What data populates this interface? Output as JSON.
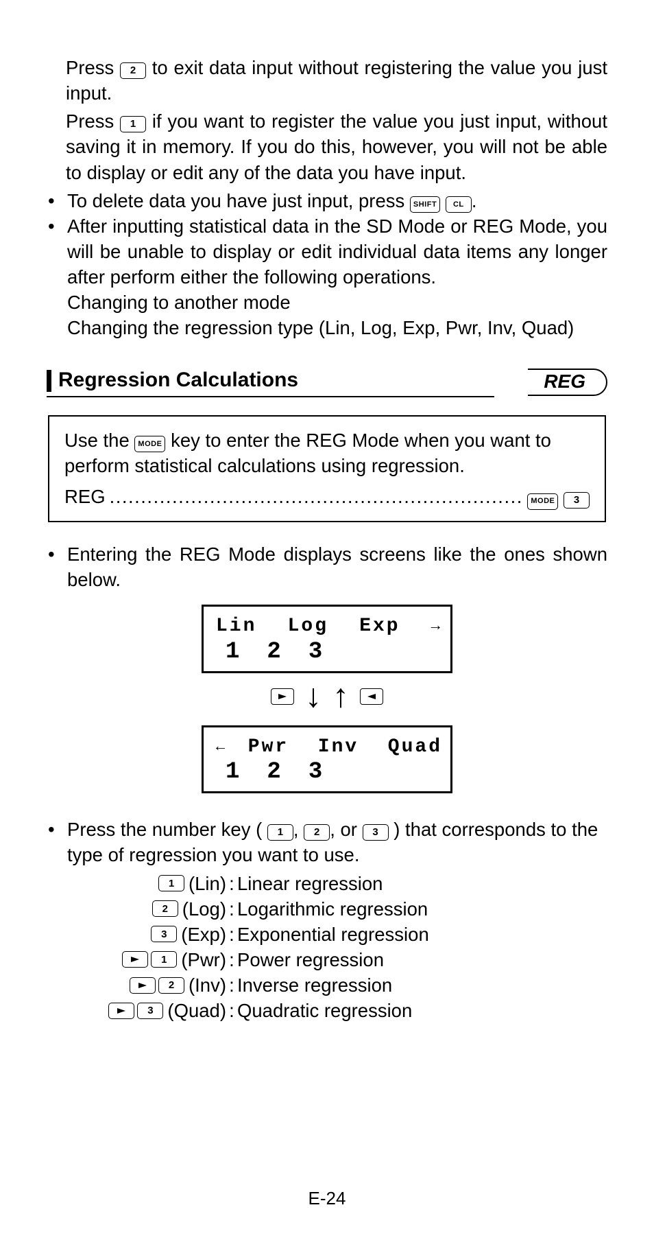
{
  "top": {
    "p1a": "Press ",
    "p1b": " to exit data input without registering the value you just input.",
    "p2a": "Press ",
    "p2b": " if you want to register the value you just input, without saving it in memory. If you do this, however, you will not be able to display or edit any of the data you have input."
  },
  "bul1": {
    "a": "To delete data you have just input, press ",
    "b": "."
  },
  "bul2": {
    "a": "After inputting statistical data in the SD Mode or REG Mode, you will be unable to display or edit individual data items any longer after perform either the following operations.",
    "b": "Changing to another mode",
    "c": "Changing the regression type (Lin, Log, Exp, Pwr, Inv, Quad)"
  },
  "section": {
    "title": "Regression Calculations",
    "badge": "REG"
  },
  "box": {
    "line1a": "Use the ",
    "line1b": " key to enter the REG Mode when you want to perform statistical calculations using regression.",
    "reg_label": "REG",
    "dots": ".................................................................."
  },
  "bul3": "Entering the REG Mode displays screens like the ones shown below.",
  "lcd1": {
    "c1": "Lin",
    "c2": "Log",
    "c3": "Exp",
    "n1": "1",
    "n2": "2",
    "n3": "3"
  },
  "lcd2": {
    "c1": "Pwr",
    "c2": "Inv",
    "c3": "Quad",
    "n1": "1",
    "n2": "2",
    "n3": "3"
  },
  "swap": {
    "down": "↓",
    "up": "↑"
  },
  "bul4": {
    "a": "Press the number key (",
    "mid1": ", ",
    "mid2": ", or ",
    "b": ") that corresponds to the type of regression you want to use."
  },
  "keys": {
    "k1": "1",
    "k2": "2",
    "k3": "3",
    "mode": "MODE",
    "shift": "SHIFT",
    "cl": "CL"
  },
  "regtypes": [
    {
      "arrow": false,
      "key": "1",
      "short": "(Lin)",
      "desc": "Linear regression"
    },
    {
      "arrow": false,
      "key": "2",
      "short": "(Log)",
      "desc": "Logarithmic regression"
    },
    {
      "arrow": false,
      "key": "3",
      "short": "(Exp)",
      "desc": "Exponential regression"
    },
    {
      "arrow": true,
      "key": "1",
      "short": "(Pwr)",
      "desc": "Power regression"
    },
    {
      "arrow": true,
      "key": "2",
      "short": "(Inv)",
      "desc": "Inverse regression"
    },
    {
      "arrow": true,
      "key": "3",
      "short": "(Quad)",
      "desc": "Quadratic regression"
    }
  ],
  "page_num": "E-24"
}
